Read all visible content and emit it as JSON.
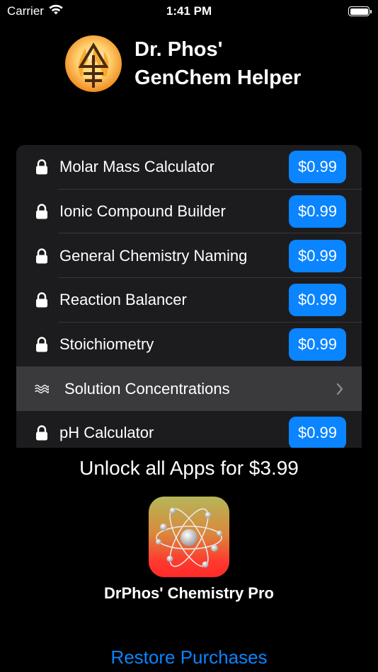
{
  "status_bar": {
    "carrier": "Carrier",
    "time": "1:41 PM"
  },
  "header": {
    "title_line1": "Dr. Phos'",
    "title_line2": "GenChem Helper"
  },
  "list": {
    "items": [
      {
        "label": "Molar Mass Calculator",
        "price": "$0.99",
        "icon": "lock-icon"
      },
      {
        "label": "Ionic Compound Builder",
        "price": "$0.99",
        "icon": "lock-icon"
      },
      {
        "label": "General Chemistry Naming",
        "price": "$0.99",
        "icon": "lock-icon"
      },
      {
        "label": "Reaction Balancer",
        "price": "$0.99",
        "icon": "lock-icon"
      },
      {
        "label": "Stoichiometry",
        "price": "$0.99",
        "icon": "lock-icon"
      },
      {
        "label": "Solution Concentrations",
        "icon": "waves-icon"
      },
      {
        "label": "pH Calculator",
        "price": "$0.99",
        "icon": "lock-icon"
      }
    ]
  },
  "unlock": {
    "text": "Unlock all Apps for $3.99",
    "pro_name": "DrPhos' Chemistry Pro"
  },
  "restore": {
    "label": "Restore Purchases"
  },
  "colors": {
    "accent": "#0a84ff",
    "background": "#000000",
    "card": "#1c1c1e",
    "selected_row": "#3a3a3c"
  }
}
